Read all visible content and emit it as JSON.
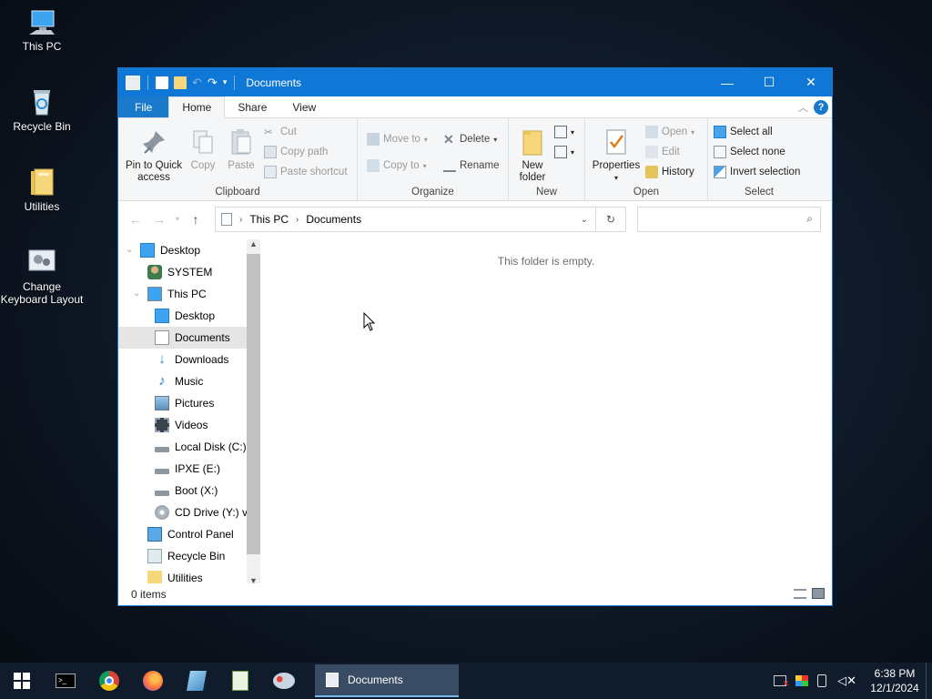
{
  "desktop_icons": [
    {
      "label": "This PC",
      "icon": "this-pc-icon"
    },
    {
      "label": "Recycle Bin",
      "icon": "recycle-bin-icon"
    },
    {
      "label": "Utilities",
      "icon": "folder-icon"
    },
    {
      "label_line1": "Change",
      "label_line2": "Keyboard Layout",
      "icon": "keyboard-layout-icon"
    }
  ],
  "window": {
    "title": "Documents",
    "tabs": {
      "file": "File",
      "home": "Home",
      "share": "Share",
      "view": "View"
    },
    "help": "?",
    "ribbon": {
      "clipboard": {
        "pin_line1": "Pin to Quick",
        "pin_line2": "access",
        "copy": "Copy",
        "paste": "Paste",
        "cut": "Cut",
        "copy_path": "Copy path",
        "paste_shortcut": "Paste shortcut",
        "label": "Clipboard"
      },
      "organize": {
        "move_to": "Move to",
        "copy_to": "Copy to",
        "delete": "Delete",
        "rename": "Rename",
        "label": "Organize"
      },
      "new": {
        "new_folder_line1": "New",
        "new_folder_line2": "folder",
        "label": "New"
      },
      "open": {
        "properties": "Properties",
        "open": "Open",
        "edit": "Edit",
        "history": "History",
        "label": "Open"
      },
      "select": {
        "select_all": "Select all",
        "select_none": "Select none",
        "invert": "Invert selection",
        "label": "Select"
      }
    },
    "address": {
      "crumbs": [
        "This PC",
        "Documents"
      ],
      "search_placeholder": ""
    },
    "nav_tree": [
      {
        "label": "Desktop",
        "icon": "desktop-icon",
        "indent": 0
      },
      {
        "label": "SYSTEM",
        "icon": "user-icon",
        "indent": 1
      },
      {
        "label": "This PC",
        "icon": "this-pc-icon",
        "indent": 1
      },
      {
        "label": "Desktop",
        "icon": "desktop-icon",
        "indent": 2
      },
      {
        "label": "Documents",
        "icon": "documents-icon",
        "indent": 2,
        "selected": true
      },
      {
        "label": "Downloads",
        "icon": "downloads-icon",
        "indent": 2
      },
      {
        "label": "Music",
        "icon": "music-icon",
        "indent": 2
      },
      {
        "label": "Pictures",
        "icon": "pictures-icon",
        "indent": 2
      },
      {
        "label": "Videos",
        "icon": "videos-icon",
        "indent": 2
      },
      {
        "label": "Local Disk (C:)",
        "icon": "drive-icon",
        "indent": 2
      },
      {
        "label": "IPXE (E:)",
        "icon": "drive-icon",
        "indent": 2
      },
      {
        "label": "Boot (X:)",
        "icon": "drive-icon",
        "indent": 2
      },
      {
        "label": "CD Drive (Y:) vi",
        "icon": "cd-drive-icon",
        "indent": 2
      },
      {
        "label": "Control Panel",
        "icon": "control-panel-icon",
        "indent": 1
      },
      {
        "label": "Recycle Bin",
        "icon": "recycle-bin-icon",
        "indent": 1
      },
      {
        "label": "Utilities",
        "icon": "folder-icon",
        "indent": 1
      }
    ],
    "content": {
      "empty_message": "This folder is empty."
    },
    "status": {
      "items": "0 items"
    }
  },
  "taskbar": {
    "apps": [
      "start-icon",
      "terminal-icon",
      "chrome-icon",
      "firefox-icon",
      "notepad-icon",
      "spreadsheet-icon",
      "paint-icon"
    ],
    "active_window": "Documents",
    "time": "6:38 PM",
    "date": "12/1/2024"
  },
  "colors": {
    "titlebar": "#0f78d7",
    "accent": "#1979ca",
    "taskbar": "#101c2b",
    "selection": "#e5e5e5"
  }
}
